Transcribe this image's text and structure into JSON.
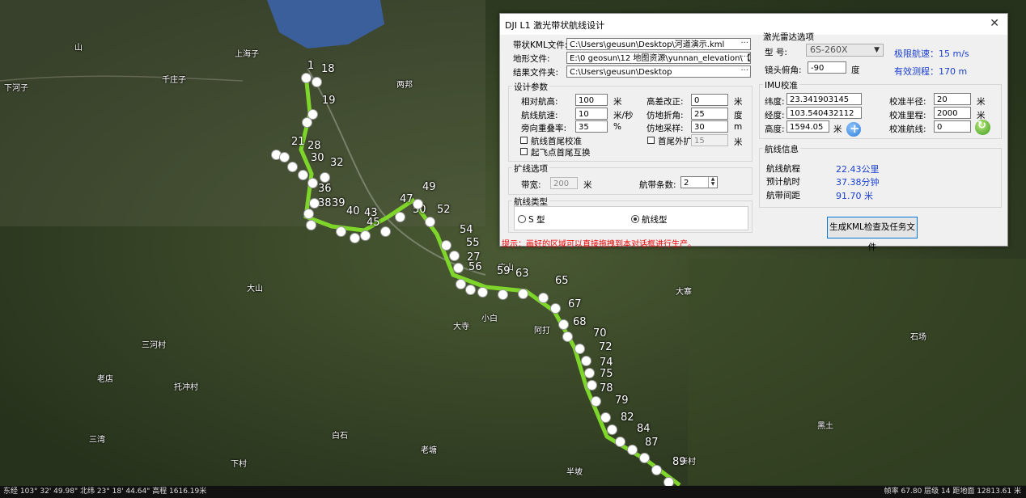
{
  "map": {
    "labels": [
      "山",
      "千庄子",
      "上海子",
      "下河子",
      "两邦",
      "大山",
      "广山",
      "三河村",
      "大寺",
      "托冲村",
      "老店",
      "老塘",
      "白石",
      "三湾",
      "石场",
      "下村",
      "半坡",
      "大寨",
      "黑土",
      "阿打",
      "小白",
      "泰村"
    ],
    "waypoints": [
      "1",
      "18",
      "19",
      "21",
      "28",
      "30",
      "32",
      "36",
      "38",
      "39",
      "40",
      "43",
      "45",
      "47",
      "49",
      "50",
      "52",
      "54",
      "55",
      "27",
      "56",
      "59",
      "63",
      "65",
      "67",
      "68",
      "70",
      "72",
      "74",
      "75",
      "78",
      "79",
      "82",
      "84",
      "87",
      "89"
    ],
    "route_color": "#7fd62a"
  },
  "status": {
    "left": "东经 103° 32' 49.98\"  北纬 23° 18' 44.64\"  高程 1616.19米",
    "right": "帧率 67.80  层级 14  距地面 12813.61 米"
  },
  "dialog": {
    "title": "DJI L1 激光带状航线设计",
    "close": "✕",
    "files": {
      "kml_label": "带状KML文件:",
      "kml_value": "C:\\Users\\geusun\\Desktop\\河道演示.kml",
      "terrain_label": "地形文件:",
      "terrain_value": "E:\\0 geosun\\12 地图资源\\yunnan_elevation\\【红河哈",
      "result_label": "结果文件夹:",
      "result_value": "C:\\Users\\geusun\\Desktop",
      "browse": "···"
    },
    "design": {
      "group": "设计参数",
      "rel_height_label": "相对航高:",
      "rel_height": "100",
      "rel_height_unit": "米",
      "speed_label": "航线航速:",
      "speed": "10",
      "speed_unit": "米/秒",
      "overlap_label": "旁向重叠率:",
      "overlap": "35",
      "overlap_unit": "%",
      "elev_fix_label": "高差改正:",
      "elev_fix": "0",
      "elev_fix_unit": "米",
      "terrain_angle_label": "仿地折角:",
      "terrain_angle": "25",
      "terrain_angle_unit": "度",
      "terrain_sample_label": "仿地采样:",
      "terrain_sample": "30",
      "terrain_sample_unit": "m",
      "chk_first_last": "航线首尾校准",
      "chk_swap": "起飞点首尾互换",
      "chk_extend": "首尾外扩",
      "extend_value": "15",
      "extend_unit": "米"
    },
    "expand": {
      "group": "扩线选项",
      "width_label": "带宽:",
      "width": "200",
      "width_unit": "米",
      "count_label": "航带条数:",
      "count": "2"
    },
    "route_type": {
      "group": "航线类型",
      "s_type": "S 型",
      "route": "航线型"
    },
    "hint": "提示：画好的区域可以直接拖拽到本对话框进行生产。",
    "lidar": {
      "group": "激光雷达选项",
      "model_label": "型  号:",
      "model": "6S-260X",
      "max_speed": "极限航速：15 m/s",
      "tilt_label": "镜头俯角:",
      "tilt": "-90",
      "tilt_unit": "度",
      "range": "有效测程：170 m"
    },
    "imu": {
      "group": "IMU校准",
      "lat_label": "纬度:",
      "lat": "23.341903145",
      "lon_label": "经度:",
      "lon": "103.540432112",
      "alt_label": "高度:",
      "alt": "1594.05",
      "alt_unit": "米",
      "radius_label": "校准半径:",
      "radius": "20",
      "radius_unit": "米",
      "distance_label": "校准里程:",
      "distance": "2000",
      "distance_unit": "米",
      "route_label": "校准航线:",
      "route": "0"
    },
    "info": {
      "group": "航线信息",
      "length_label": "航线航程",
      "length": "22.43公里",
      "time_label": "预计航时",
      "time": "37.38分钟",
      "spacing_label": "航带间距",
      "spacing": "91.70 米"
    },
    "generate": "生成KML检查及任务文件"
  }
}
